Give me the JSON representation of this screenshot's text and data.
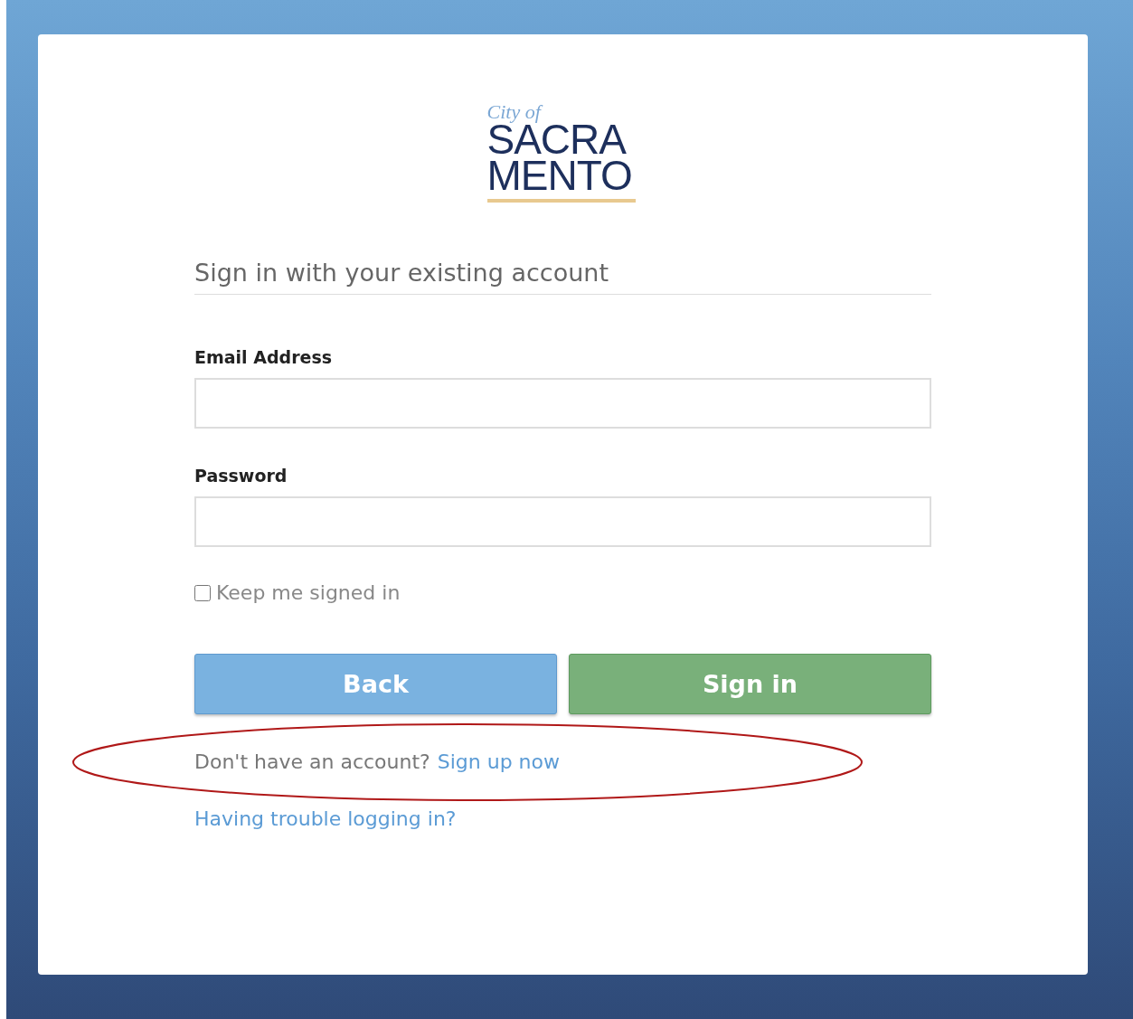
{
  "logo": {
    "prefix": "City of",
    "lines": [
      "SACRA",
      "MENTO"
    ]
  },
  "heading": "Sign in with your existing account",
  "fields": [
    {
      "label": "Email Address"
    },
    {
      "label": "Password"
    }
  ],
  "keep_signed_in": {
    "label": "Keep me signed in",
    "checked": false
  },
  "buttons": [
    {
      "label": "Back",
      "kind": "secondary"
    },
    {
      "label": "Sign in",
      "kind": "primary"
    }
  ],
  "signup": {
    "text": "Don't have an account?",
    "link": "Sign up now",
    "circled": true
  },
  "trouble_link": "Having trouble logging in?"
}
